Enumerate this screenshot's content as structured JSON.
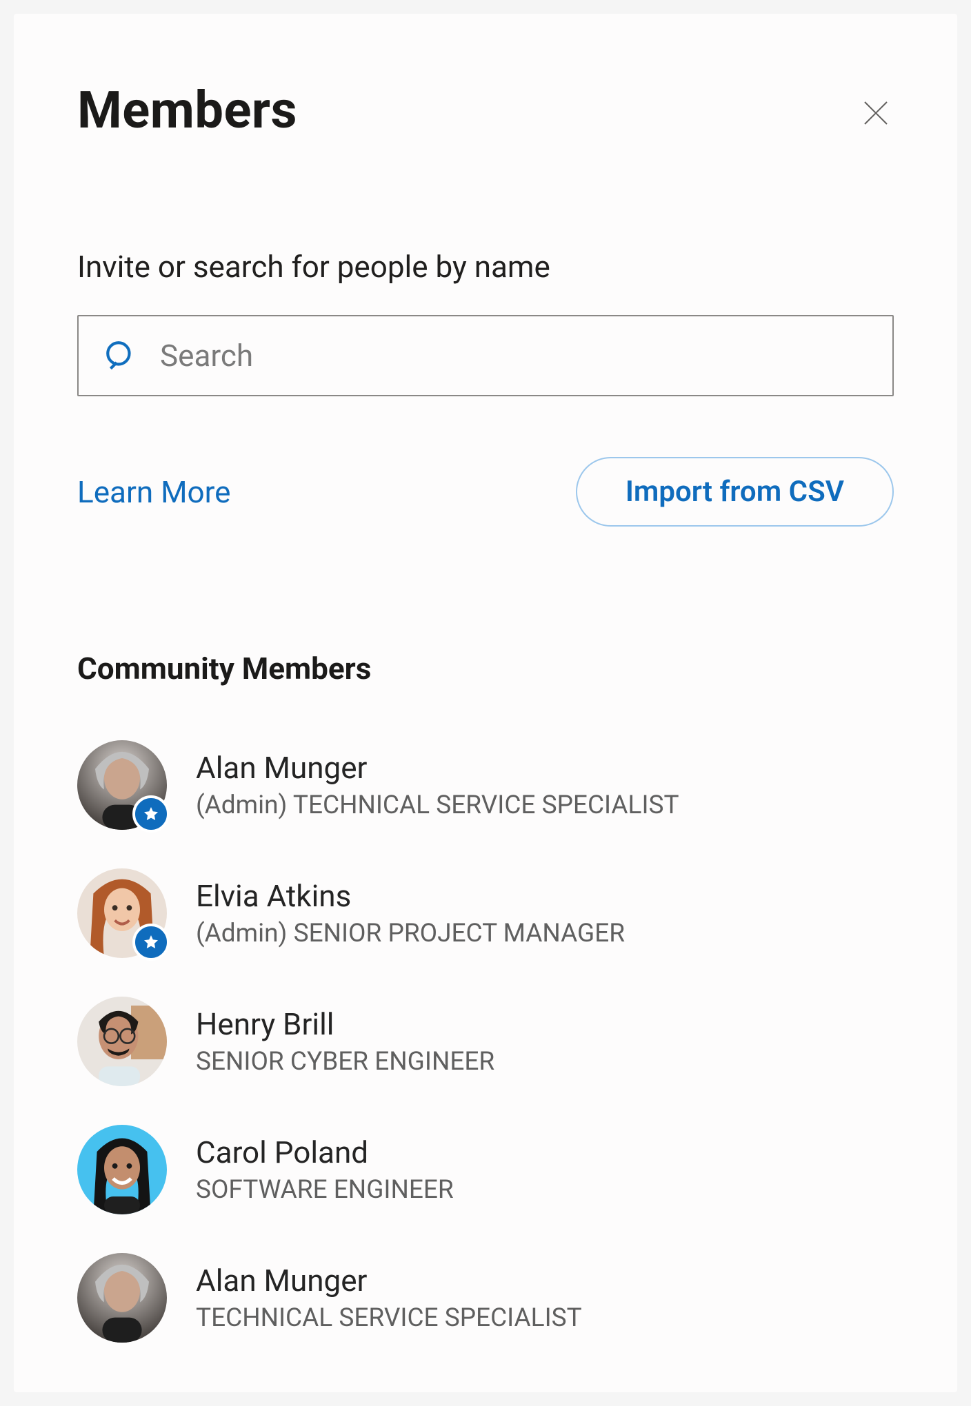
{
  "header": {
    "title": "Members"
  },
  "search": {
    "label": "Invite or search for people by name",
    "placeholder": "Search"
  },
  "actions": {
    "learn_more": "Learn More",
    "import_csv": "Import from CSV"
  },
  "section": {
    "title": "Community Members"
  },
  "members": [
    {
      "name": "Alan Munger",
      "role": "(Admin) TECHNICAL SERVICE SPECIALIST",
      "isAdmin": true,
      "avatarKey": "alan"
    },
    {
      "name": "Elvia Atkins",
      "role": "(Admin) SENIOR PROJECT MANAGER",
      "isAdmin": true,
      "avatarKey": "elvia"
    },
    {
      "name": "Henry Brill",
      "role": "SENIOR CYBER ENGINEER",
      "isAdmin": false,
      "avatarKey": "henry"
    },
    {
      "name": "Carol Poland",
      "role": "SOFTWARE ENGINEER",
      "isAdmin": false,
      "avatarKey": "carol"
    },
    {
      "name": "Alan Munger",
      "role": "TECHNICAL SERVICE SPECIALIST",
      "isAdmin": false,
      "avatarKey": "alan"
    }
  ]
}
